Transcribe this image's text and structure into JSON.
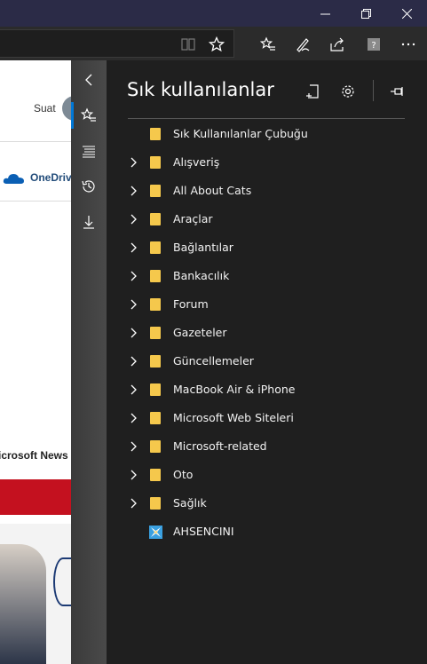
{
  "page": {
    "user_name": "Suat",
    "onedrive_label": "OneDriv",
    "news_label": "icrosoft News"
  },
  "hub": {
    "title": "Sık kullanılanlar",
    "items": [
      {
        "label": "Sık Kullanılanlar Çubuğu",
        "type": "folder",
        "expandable": false
      },
      {
        "label": "Alışveriş",
        "type": "folder",
        "expandable": true
      },
      {
        "label": "All About Cats",
        "type": "folder",
        "expandable": true
      },
      {
        "label": "Araçlar",
        "type": "folder",
        "expandable": true
      },
      {
        "label": "Bağlantılar",
        "type": "folder",
        "expandable": true
      },
      {
        "label": "Bankacılık",
        "type": "folder",
        "expandable": true
      },
      {
        "label": "Forum",
        "type": "folder",
        "expandable": true
      },
      {
        "label": "Gazeteler",
        "type": "folder",
        "expandable": true
      },
      {
        "label": "Güncellemeler",
        "type": "folder",
        "expandable": true
      },
      {
        "label": "MacBook Air & iPhone",
        "type": "folder",
        "expandable": true
      },
      {
        "label": "Microsoft Web Siteleri",
        "type": "folder",
        "expandable": true
      },
      {
        "label": "Microsoft-related",
        "type": "folder",
        "expandable": true
      },
      {
        "label": "Oto",
        "type": "folder",
        "expandable": true
      },
      {
        "label": "Sağlık",
        "type": "folder",
        "expandable": true
      },
      {
        "label": "AHSENCINI",
        "type": "site",
        "expandable": false
      }
    ]
  },
  "colors": {
    "accent": "#0078d7",
    "folder": "#f5c84c",
    "titlebar": "#2b2b47",
    "panel": "#1f1f1f"
  }
}
